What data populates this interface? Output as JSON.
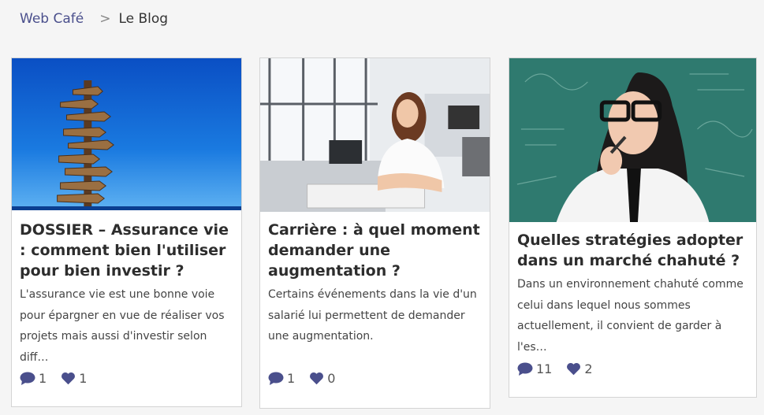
{
  "breadcrumb": {
    "home": "Web Café",
    "separator": ">",
    "current": "Le Blog"
  },
  "colors": {
    "accent": "#4a4f8c",
    "card_border": "#d4d4d4",
    "background": "#f5f5f5"
  },
  "posts": [
    {
      "title": "DOSSIER – Assurance vie : comment bien l'utiliser pour bien investir ?",
      "excerpt": "L'assurance vie est une bonne voie pour épargner en vue de réaliser vos projets mais aussi d'investir selon diff…",
      "comments": "1",
      "likes": "1",
      "image": "signpost-photo"
    },
    {
      "title": "Carrière : à quel moment demander une augmentation ?",
      "excerpt": "Certains événements dans la vie d'un salarié lui permettent de demander une augmentation.",
      "comments": "1",
      "likes": "0",
      "image": "office-woman-photo"
    },
    {
      "title": "Quelles stratégies adopter dans un marché chahuté ?",
      "excerpt": "Dans un environnement chahuté comme celui dans lequel nous sommes actuellement, il convient de garder à l'es…",
      "comments": "11",
      "likes": "2",
      "image": "chalkboard-woman-photo"
    }
  ]
}
